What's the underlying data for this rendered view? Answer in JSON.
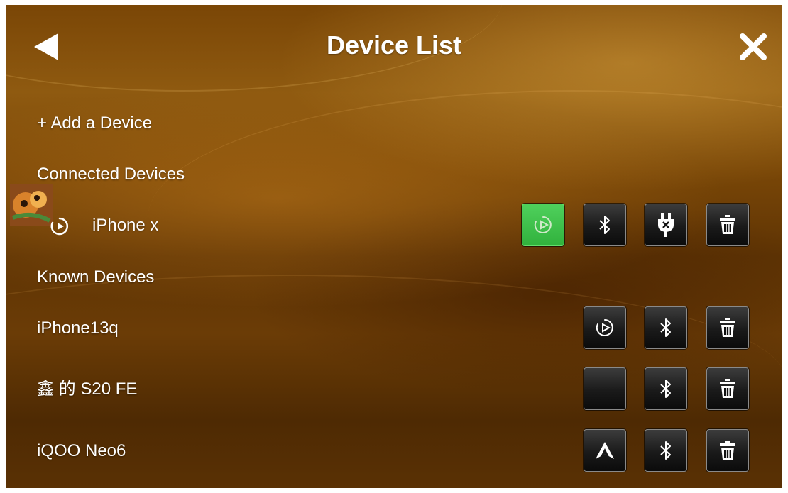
{
  "header": {
    "title": "Device List",
    "back_icon": "back-arrow-icon",
    "close_icon": "close-icon"
  },
  "actions": {
    "add_label": "+ Add a Device"
  },
  "sections": {
    "connected_label": "Connected Devices",
    "known_label": "Known Devices"
  },
  "connected_device": {
    "name": "iPhone x",
    "status_icon": "carplay-icon",
    "buttons": [
      "carplay-icon",
      "bluetooth-icon",
      "disconnect-plug-icon",
      "trash-icon"
    ],
    "active_button_color": "#3bbf46"
  },
  "known_devices": [
    {
      "name": "iPhone13q",
      "buttons": [
        "carplay-icon",
        "bluetooth-icon",
        "trash-icon"
      ]
    },
    {
      "name": "鑫 的 S20 FE",
      "buttons": [
        "blank",
        "bluetooth-icon",
        "trash-icon"
      ]
    },
    {
      "name": "iQOO Neo6",
      "buttons": [
        "android-auto-icon",
        "bluetooth-icon",
        "trash-icon"
      ]
    }
  ]
}
